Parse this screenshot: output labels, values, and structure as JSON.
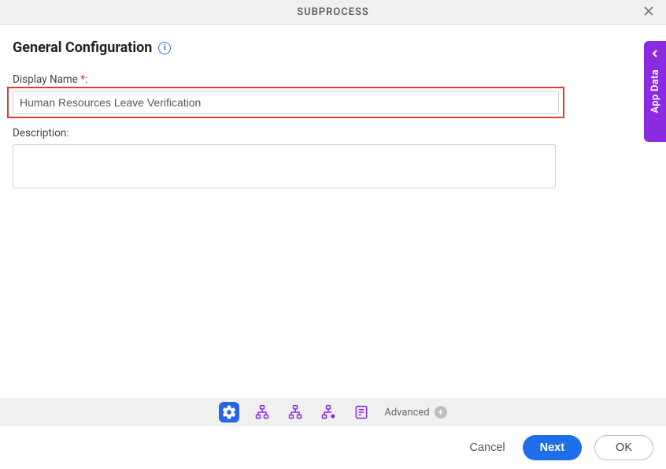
{
  "titlebar": {
    "title": "SUBPROCESS"
  },
  "section": {
    "heading": "General Configuration"
  },
  "fields": {
    "display_name": {
      "label": "Display Name",
      "required_mark": "*",
      "suffix": ":",
      "value": "Human Resources Leave Verification"
    },
    "description": {
      "label": "Description:",
      "value": ""
    }
  },
  "side_tab": {
    "label": "App Data"
  },
  "toolbar": {
    "advanced_label": "Advanced",
    "icons": [
      "gear-icon",
      "sitemap-icon",
      "sitemap-icon",
      "sitemap-gear-icon",
      "form-icon"
    ]
  },
  "footer": {
    "cancel": "Cancel",
    "next": "Next",
    "ok": "OK"
  },
  "colors": {
    "primary": "#1e6ee8",
    "accent": "#8a2be2",
    "highlight": "#e03b2e"
  }
}
